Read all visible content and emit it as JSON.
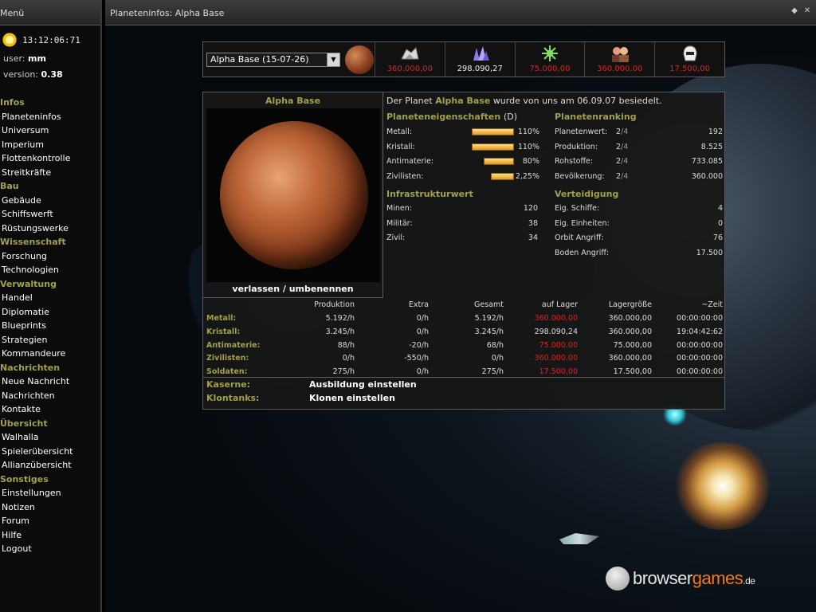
{
  "menu": {
    "title": "Menü",
    "clock": "13:12:06:71",
    "user_label": "user:",
    "user_value": "mm",
    "version_label": "version:",
    "version_value": "0.38",
    "sections": [
      {
        "head": "Infos",
        "items": [
          "Planeteninfos",
          "Universum",
          "Imperium",
          "Flottenkontrolle",
          "Streitkräfte"
        ]
      },
      {
        "head": "Bau",
        "items": [
          "Gebäude",
          "Schiffswerft",
          "Rüstungswerke"
        ]
      },
      {
        "head": "Wissenschaft",
        "items": [
          "Forschung",
          "Technologien"
        ]
      },
      {
        "head": "Verwaltung",
        "items": [
          "Handel",
          "Diplomatie",
          "Blueprints",
          "Strategien",
          "Kommandeure"
        ]
      },
      {
        "head": "Nachrichten",
        "items": [
          "Neue Nachricht",
          "Nachrichten",
          "Kontakte"
        ]
      },
      {
        "head": "Übersicht",
        "items": [
          "Walhalla",
          "Spielerübersicht",
          "Allianzübersicht"
        ]
      },
      {
        "head": "Sonstiges",
        "items": [
          "Einstellungen",
          "Notizen",
          "Forum",
          "Hilfe",
          "Logout"
        ]
      }
    ]
  },
  "window": {
    "title": "Planeteninfos: Alpha Base",
    "icons": [
      "move-icon",
      "close-icon"
    ]
  },
  "resbar": {
    "selected_planet": "Alpha Base (15-07-26)",
    "resources": [
      {
        "name": "metal",
        "icon": "metal-icon",
        "value": "360.000,00",
        "color": "#e02020"
      },
      {
        "name": "crystal",
        "icon": "crystal-icon",
        "value": "298.090,27",
        "color": "#eeeeee"
      },
      {
        "name": "antimatter",
        "icon": "antimatter-icon",
        "value": "75.000,00",
        "color": "#e02020"
      },
      {
        "name": "civilians",
        "icon": "civilians-icon",
        "value": "360.000,00",
        "color": "#e02020"
      },
      {
        "name": "soldiers",
        "icon": "soldier-icon",
        "value": "17.500,00",
        "color": "#e02020"
      }
    ]
  },
  "planet": {
    "name": "Alpha Base",
    "actions": "verlassen / umbenennen",
    "desc_prefix": "Der Planet",
    "desc_name": "Alpha Base",
    "desc_suffix": "wurde von uns am 06.09.07 besiedelt."
  },
  "properties": {
    "head": "Planeteneigenschaften",
    "head_suffix": "(D)",
    "rows": [
      {
        "label": "Metall:",
        "value": "110%",
        "level": 1.1
      },
      {
        "label": "Kristall:",
        "value": "110%",
        "level": 1.1
      },
      {
        "label": "Antimaterie:",
        "value": "80%",
        "level": 0.8
      },
      {
        "label": "Zivilisten:",
        "value": "2,25%",
        "level": 0.6
      }
    ]
  },
  "ranking": {
    "head": "Planetenranking",
    "rows": [
      {
        "label": "Planetenwert:",
        "rank": "2",
        "of": "/4",
        "value": "192"
      },
      {
        "label": "Produktion:",
        "rank": "2",
        "of": "/4",
        "value": "8.525"
      },
      {
        "label": "Rohstoffe:",
        "rank": "2",
        "of": "/4",
        "value": "733.085"
      },
      {
        "label": "Bevölkerung:",
        "rank": "2",
        "of": "/4",
        "value": "360.000"
      }
    ]
  },
  "infrastructure": {
    "head": "Infrastrukturwert",
    "rows": [
      {
        "label": "Minen:",
        "value": "120"
      },
      {
        "label": "Militär:",
        "value": "38"
      },
      {
        "label": "Zivil:",
        "value": "34"
      }
    ]
  },
  "defense": {
    "head": "Verteidigung",
    "rows": [
      {
        "label": "Eig. Schiffe:",
        "value": "4"
      },
      {
        "label": "Eig. Einheiten:",
        "value": "0"
      },
      {
        "label": "Orbit Angriff:",
        "value": "76"
      },
      {
        "label": "Boden Angriff:",
        "value": "17.500"
      }
    ]
  },
  "production": {
    "headers": [
      "Produktion",
      "Extra",
      "Gesamt",
      "auf Lager",
      "Lagergröße",
      "~Zeit"
    ],
    "rows": [
      {
        "label": "Metall:",
        "cells": [
          "5.192/h",
          "0/h",
          "5.192/h",
          "360.000,00",
          "360.000,00",
          "00:00:00:00"
        ],
        "lager_red": true
      },
      {
        "label": "Kristall:",
        "cells": [
          "3.245/h",
          "0/h",
          "3.245/h",
          "298.090,24",
          "360.000,00",
          "19:04:42:62"
        ],
        "lager_red": false
      },
      {
        "label": "Antimaterie:",
        "cells": [
          "88/h",
          "-20/h",
          "68/h",
          "75.000,00",
          "75.000,00",
          "00:00:00:00"
        ],
        "lager_red": true
      },
      {
        "label": "Zivilisten:",
        "cells": [
          "0/h",
          "-550/h",
          "0/h",
          "360.000,00",
          "360.000,00",
          "00:00:00:00"
        ],
        "lager_red": true
      },
      {
        "label": "Soldaten:",
        "cells": [
          "275/h",
          "0/h",
          "275/h",
          "17.500,00",
          "17.500,00",
          "00:00:00:00"
        ],
        "lager_red": true
      }
    ]
  },
  "actions": [
    {
      "label": "Kaserne:",
      "button": "Ausbildung einstellen"
    },
    {
      "label": "Klontanks:",
      "button": "Klonen einstellen"
    }
  ],
  "watermark": {
    "text_a": "browser",
    "text_b": "games",
    "text_c": ".de"
  },
  "colors": {
    "accent": "#a3a04a",
    "alert": "#e02020"
  }
}
